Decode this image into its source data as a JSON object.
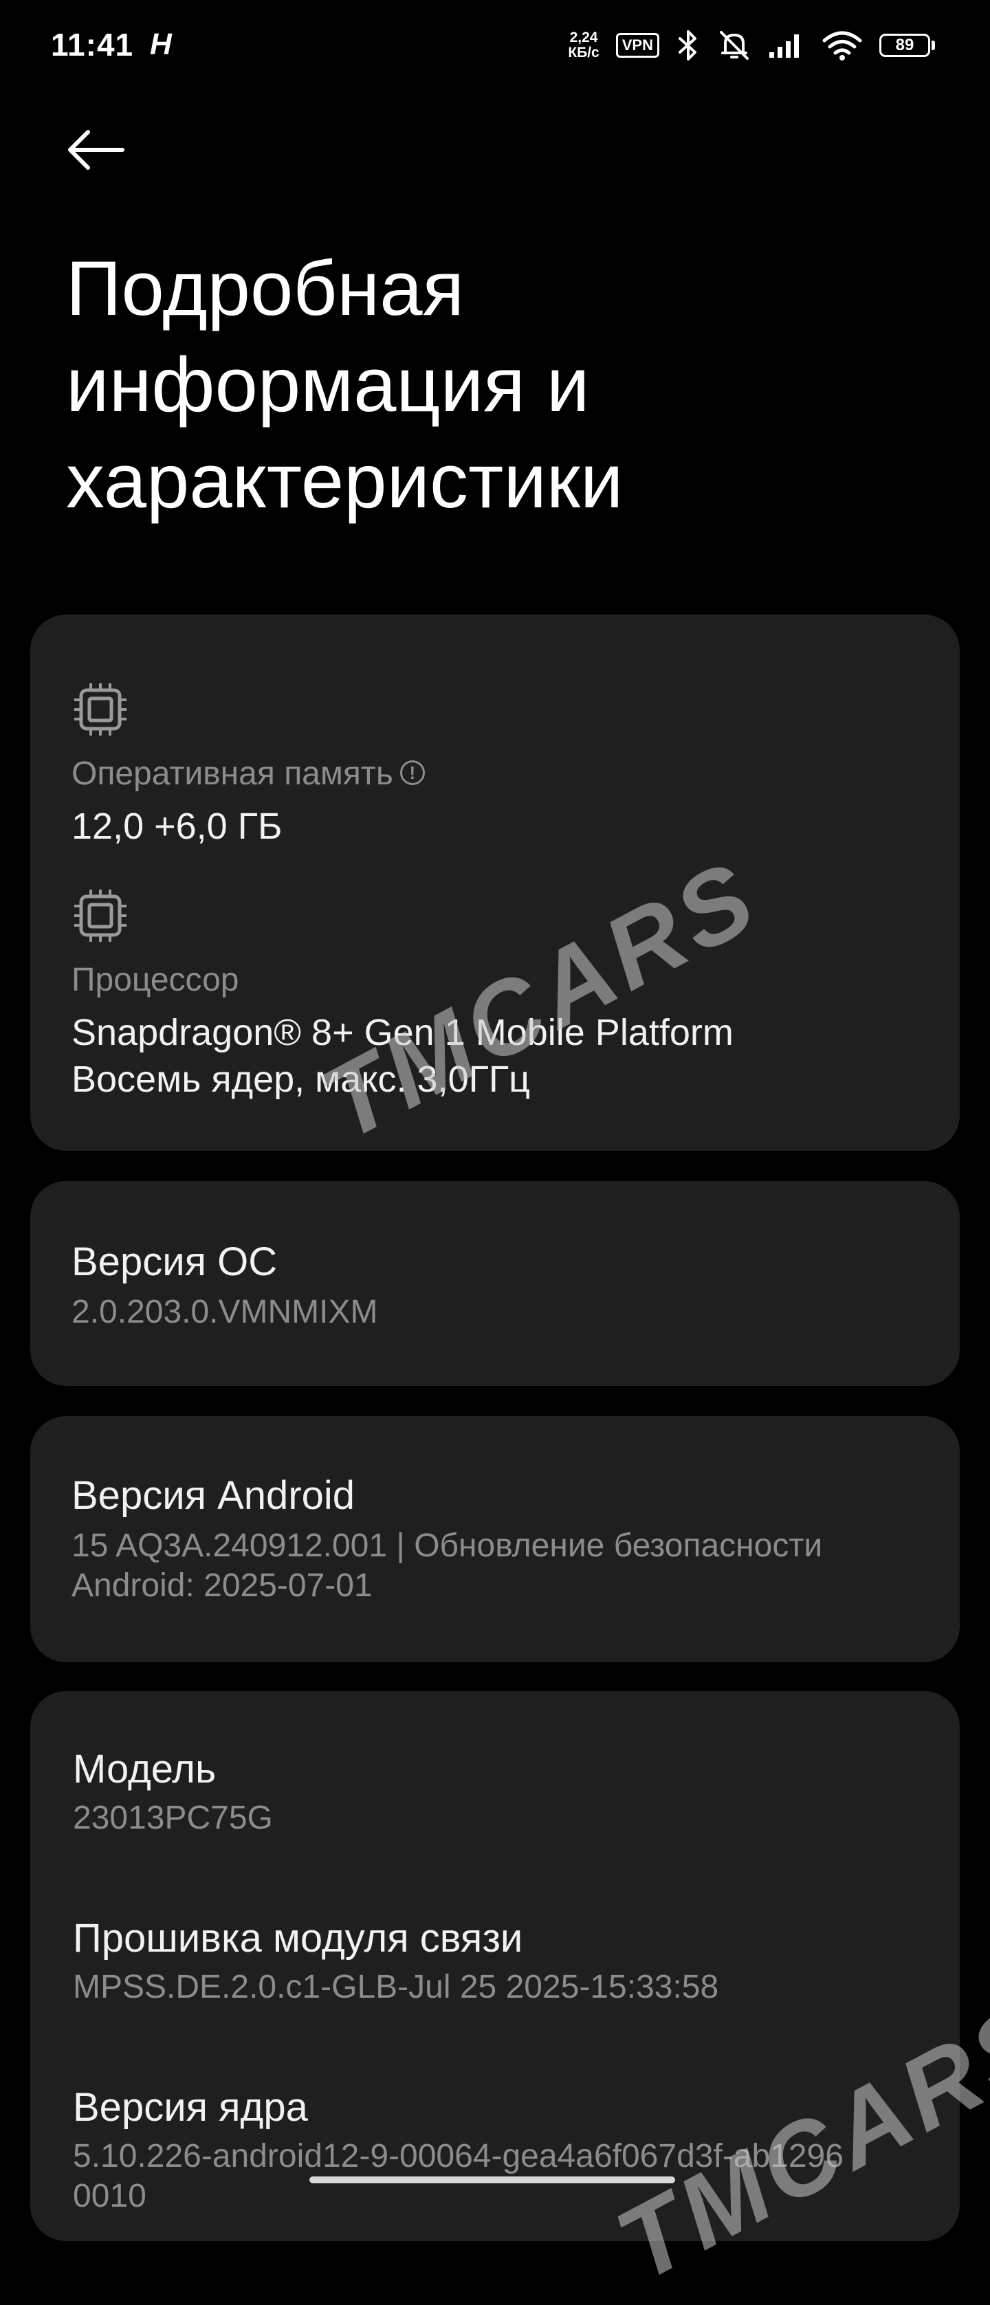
{
  "status_bar": {
    "time": "11:41",
    "app_icon": "H",
    "net_speed_value": "2,24",
    "net_speed_unit": "КБ/с",
    "vpn_label": "VPN",
    "battery_level": "89",
    "icons": [
      "bluetooth-icon",
      "mute-icon",
      "signal-icon",
      "wifi-icon",
      "battery-icon"
    ]
  },
  "header": {
    "back_icon": "arrow-left-icon",
    "title_line1": "Подробная",
    "title_line2": "информация и",
    "title_line3": "характеристики"
  },
  "hardware": {
    "ram_label": "Оперативная память",
    "ram_value": "12,0 +6,0 ГБ",
    "cpu_label": "Процессор",
    "cpu_value_line1": "Snapdragon® 8+ Gen 1 Mobile Platform",
    "cpu_value_line2": "Восемь ядер, макс. 3,0ГГц"
  },
  "os_version": {
    "title": "Версия ОС",
    "value": "2.0.203.0.VMNMIXM"
  },
  "android_version": {
    "title": "Версия Android",
    "value_line1": "15 AQ3A.240912.001 | Обновление безопасности",
    "value_line2": "Android: 2025-07-01"
  },
  "device": {
    "model_title": "Модель",
    "model_value": "23013PC75G",
    "baseband_title": "Прошивка модуля связи",
    "baseband_value": "MPSS.DE.2.0.c1-GLB-Jul 25 2025-15:33:58",
    "kernel_title": "Версия ядра",
    "kernel_value_line1": "5.10.226-android12-9-00064-gea4a6f067d3f-ab1296",
    "kernel_value_line2": "0010"
  },
  "watermark": {
    "text": "TMCARS"
  },
  "colors": {
    "background": "#000000",
    "card": "#1f1f1f",
    "primary_text": "#f2f2f2",
    "secondary_text": "#8c8c8c"
  }
}
